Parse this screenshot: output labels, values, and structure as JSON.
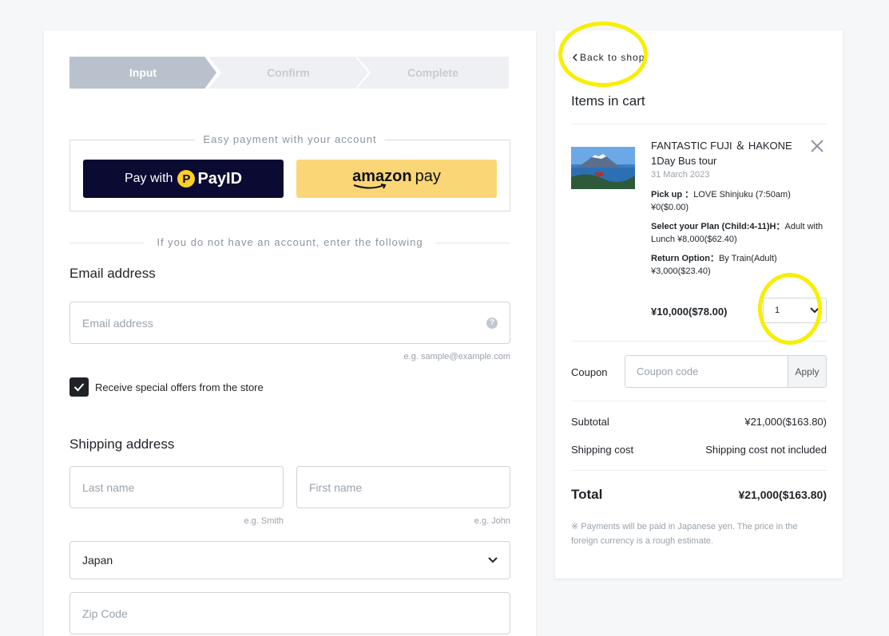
{
  "stepper": {
    "steps": [
      "Input",
      "Confirm",
      "Complete"
    ]
  },
  "easy_payment": {
    "title": "Easy payment with your account",
    "payid_prefix": "Pay with",
    "payid_logo": "P",
    "payid_brand": "PayID",
    "amazon_brand": "amazon",
    "amazon_suffix": "pay"
  },
  "divider_text": "If you do not have an account, enter the following",
  "email": {
    "section_title": "Email address",
    "placeholder": "Email address",
    "help": "?",
    "hint": "e.g. sample@example.com"
  },
  "offers": {
    "label": "Receive special offers from the store",
    "checked": true
  },
  "shipping": {
    "section_title": "Shipping address",
    "last_name_placeholder": "Last name",
    "last_name_hint": "e.g. Smith",
    "first_name_placeholder": "First name",
    "first_name_hint": "e.g. John",
    "country": "Japan",
    "zip_placeholder": "Zip Code"
  },
  "cart": {
    "back_label": "Back to shop",
    "title": "Items in cart",
    "item": {
      "name": "FANTASTIC FUJI ＆ HAKONE 1Day Bus tour",
      "date": "31 March 2023",
      "options": [
        {
          "label": "Pick up ：",
          "value": "LOVE Shinjuku (7:50am)",
          "price": "¥0($0.00)"
        },
        {
          "label": "Select your Plan (Child:4-11)H：",
          "value": "Adult with Lunch",
          "price": "¥8,000($62.40)"
        },
        {
          "label": "Return Option：",
          "value": "By Train(Adult)",
          "price": "¥3,000($23.40)"
        }
      ],
      "price": "¥10,000($78.00)",
      "quantity": "1"
    },
    "coupon_label": "Coupon",
    "coupon_placeholder": "Coupon code",
    "apply_label": "Apply",
    "subtotal_label": "Subtotal",
    "subtotal_value": "¥21,000($163.80)",
    "shipping_label": "Shipping cost",
    "shipping_value": "Shipping cost not included",
    "total_label": "Total",
    "total_value": "¥21,000($163.80)",
    "note": "※ Payments will be paid in Japanese yen. The price in the foreign currency is a rough estimate."
  },
  "colors": {
    "highlight": "#f8ee00",
    "payid_bg": "#0a0a33",
    "amazon_bg": "#fad676",
    "step_active": "#b9c1cc"
  }
}
